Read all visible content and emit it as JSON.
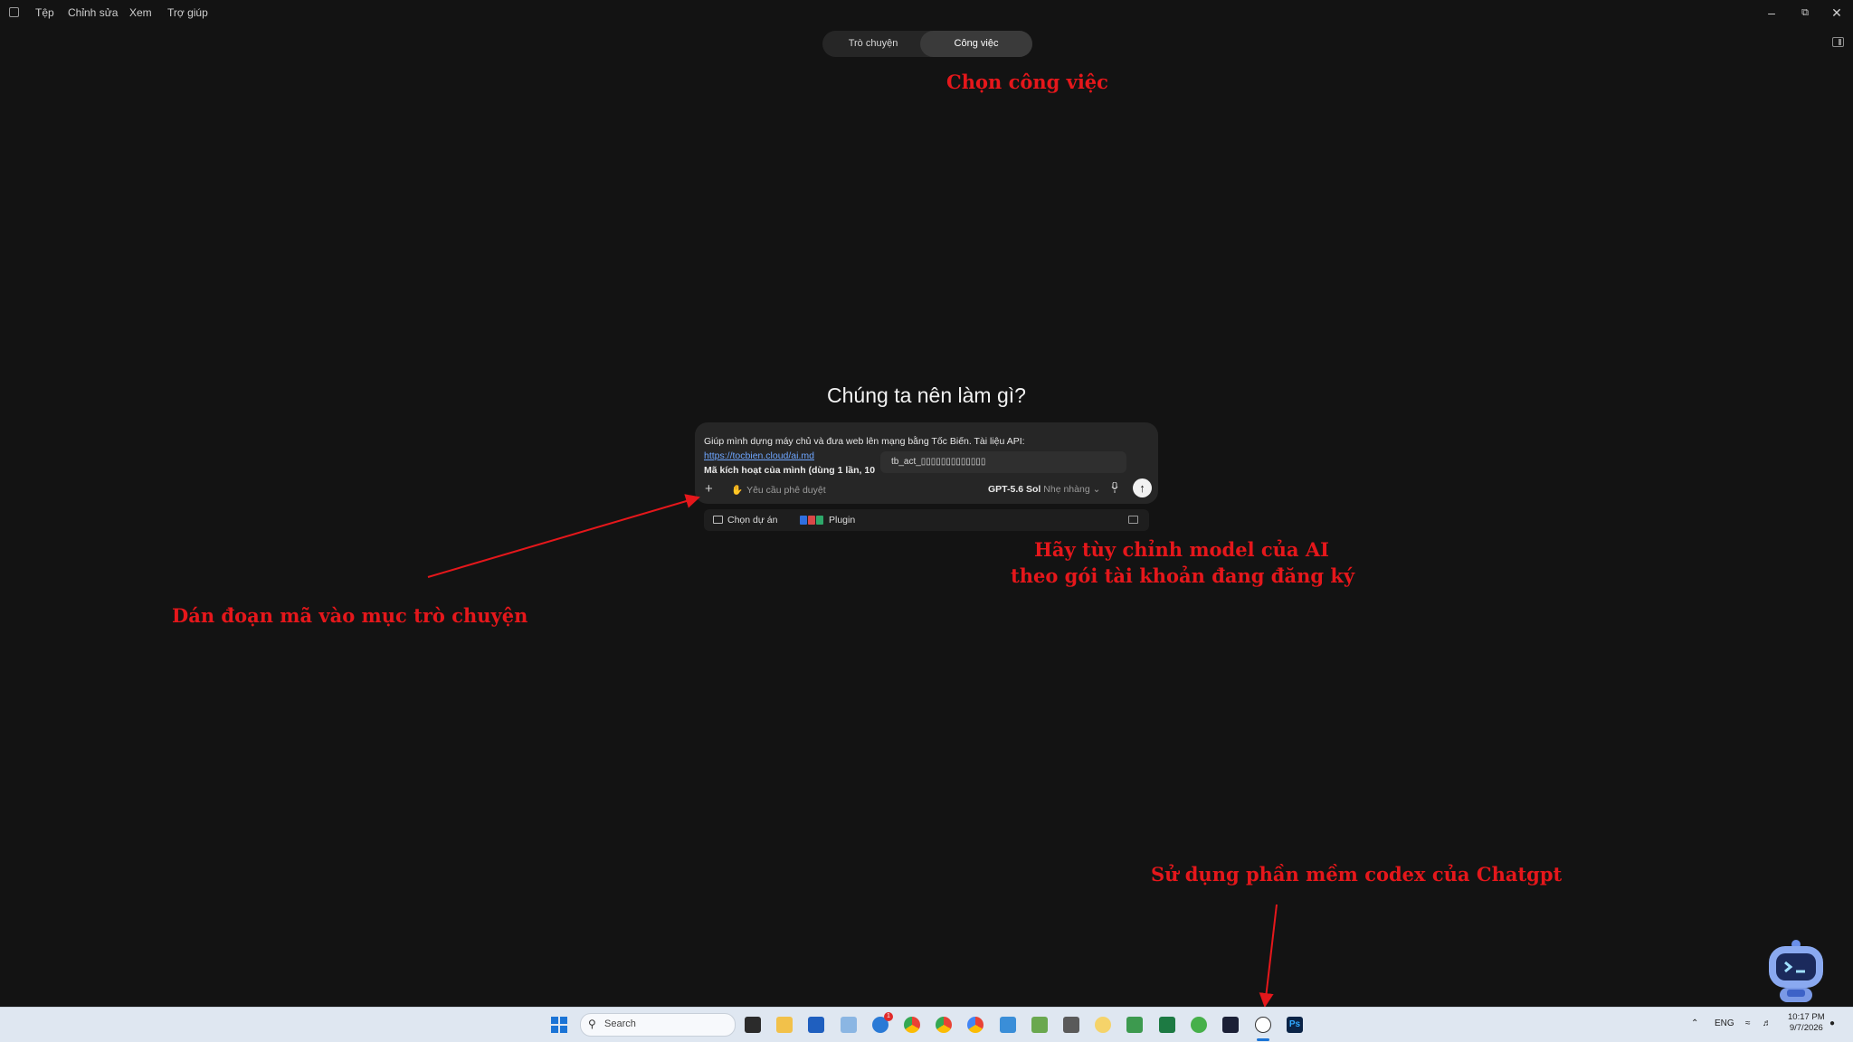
{
  "menubar": {
    "items": [
      "Tệp",
      "Chỉnh sửa",
      "Xem",
      "Trợ giúp"
    ],
    "window_controls": [
      "minimize-icon",
      "restore-icon",
      "close-icon"
    ]
  },
  "mode_toggle": {
    "tabs": [
      {
        "label": "Trò chuyện",
        "active": false
      },
      {
        "label": "Công việc",
        "active": true
      }
    ]
  },
  "heading": "Chúng ta nên làm gì?",
  "composer": {
    "line1": "Giúp mình dựng máy chủ và đưa web lên mạng bằng Tốc Biến. Tài liệu API:",
    "link": "https://tocbien.cloud/ai.md",
    "line3": "Mã kích hoạt của mình (dùng 1 lần, 10",
    "token_popup": "tb_act_▯▯▯▯▯▯▯▯▯▯▯▯▯",
    "approval": "Yêu cầu phê duyệt",
    "model": "GPT-5.6 Sol",
    "effort": "Nhẹ nhàng"
  },
  "subrow": {
    "project": "Chọn dự án",
    "plugin": "Plugin"
  },
  "annotations": {
    "choose_work": "Chọn công việc",
    "paste_code": "Dán đoạn mã vào mục trò chuyện",
    "model_line1": "Hãy tùy chỉnh model của AI",
    "model_line2": "theo gói tài khoản đang đăng ký",
    "use_codex": "Sử dụng phần mềm codex của Chatgpt"
  },
  "taskbar": {
    "search_placeholder": "Search",
    "mail_badge": "1",
    "lang": "ENG",
    "time": "10:17 PM",
    "date": "9/7/2026"
  },
  "colors": {
    "background": "#131313",
    "annotation": "#e5171b",
    "link": "#6ea6ff",
    "taskbar": "#dfe7f1"
  }
}
